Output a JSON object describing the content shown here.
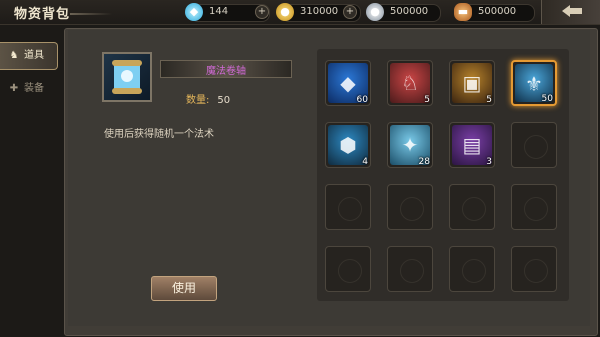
{
  "header": {
    "title": "物资背包",
    "resources": [
      {
        "name": "gem",
        "icon": "diamond-icon",
        "color": "#5fd0f5",
        "value": "144"
      },
      {
        "name": "gold",
        "icon": "gold-coin-icon",
        "color": "#e6b52e",
        "value": "310000"
      },
      {
        "name": "silver",
        "icon": "silver-coin-icon",
        "color": "#b7c3cf",
        "value": "500000"
      },
      {
        "name": "bread",
        "icon": "bread-icon",
        "color": "#d98b3a",
        "value": "500000"
      }
    ]
  },
  "tabs": [
    {
      "label": "道具",
      "icon": "bag-icon",
      "active": true
    },
    {
      "label": "装备",
      "icon": "armor-icon",
      "active": false
    }
  ],
  "detail": {
    "name": "魔法卷轴",
    "quantity_label": "数量:",
    "quantity": "50",
    "description": "使用后获得随机一个法术",
    "use_button": "使用"
  },
  "grid": {
    "items": [
      {
        "id": "blue-crystal",
        "icon": "crystal-icon",
        "count": "60",
        "color_a": "#2b78d6",
        "color_b": "#0d2b63",
        "selected": false
      },
      {
        "id": "wolf-head",
        "icon": "wolf-icon",
        "count": "5",
        "color_a": "#c94545",
        "color_b": "#4b1b1b",
        "selected": false
      },
      {
        "id": "treasure-chest",
        "icon": "chest-icon",
        "count": "5",
        "color_a": "#b7832b",
        "color_b": "#3b2410",
        "selected": false
      },
      {
        "id": "magic-scroll",
        "icon": "scroll-icon",
        "count": "50",
        "color_a": "#4aa5d8",
        "color_b": "#0f2f48",
        "selected": true
      },
      {
        "id": "golden-chest",
        "icon": "golden-box-icon",
        "count": "4",
        "color_a": "#2d89c2",
        "color_b": "#102b3f",
        "selected": false
      },
      {
        "id": "golden-scroll",
        "icon": "golden-scroll-icon",
        "count": "28",
        "color_a": "#79c9e8",
        "color_b": "#1b4e68",
        "selected": false
      },
      {
        "id": "purple-book",
        "icon": "book-icon",
        "count": "3",
        "color_a": "#7a3fa6",
        "color_b": "#2b1542",
        "selected": false
      }
    ],
    "total_slots": 16
  }
}
